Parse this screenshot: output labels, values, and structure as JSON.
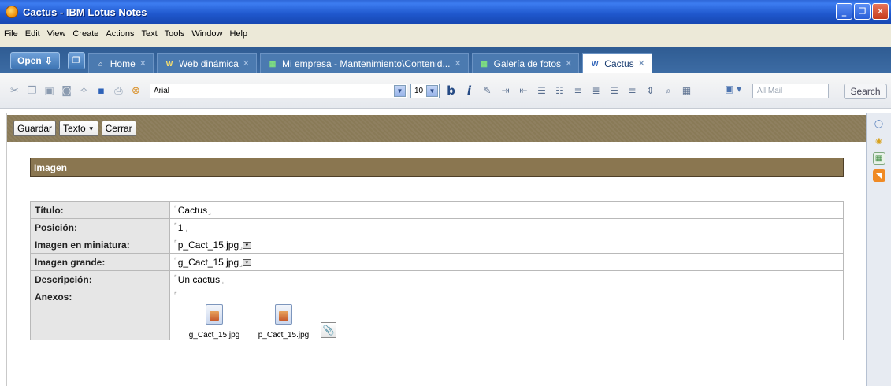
{
  "window": {
    "title": "Cactus - IBM Lotus Notes"
  },
  "menu": [
    "File",
    "Edit",
    "View",
    "Create",
    "Actions",
    "Text",
    "Tools",
    "Window",
    "Help"
  ],
  "tabbar": {
    "open_label": "Open",
    "tabs": [
      {
        "label": "Home",
        "icon": "home-icon"
      },
      {
        "label": "Web dinámica",
        "icon": "web-db-icon"
      },
      {
        "label": "Mi empresa - Mantenimiento\\Contenid...",
        "icon": "db-icon"
      },
      {
        "label": "Galería de fotos",
        "icon": "db-icon"
      },
      {
        "label": "Cactus",
        "icon": "document-icon",
        "active": true
      }
    ]
  },
  "toolbar": {
    "font": "Arial",
    "size": "10",
    "bold": "b",
    "italic": "i",
    "search_placeholder": "All Mail",
    "search_label": "Search"
  },
  "actions": {
    "save": "Guardar",
    "text": "Texto",
    "close": "Cerrar"
  },
  "form": {
    "section_title": "Imagen",
    "fields": [
      {
        "label": "Título:",
        "value": "Cactus"
      },
      {
        "label": "Posición:",
        "value": "1"
      },
      {
        "label": "Imagen en miniatura:",
        "value": "p_Cact_15.jpg"
      },
      {
        "label": "Imagen grande:",
        "value": "g_Cact_15.jpg"
      },
      {
        "label": "Descripción:",
        "value": "Un cactus"
      }
    ],
    "annex_label": "Anexos:",
    "attachments": [
      "g_Cact_15.jpg",
      "p_Cact_15.jpg"
    ]
  },
  "colors": {
    "section_bar": "#8a7650",
    "tabbar": "#2f5c93",
    "titlebar": "#1f57cc"
  }
}
